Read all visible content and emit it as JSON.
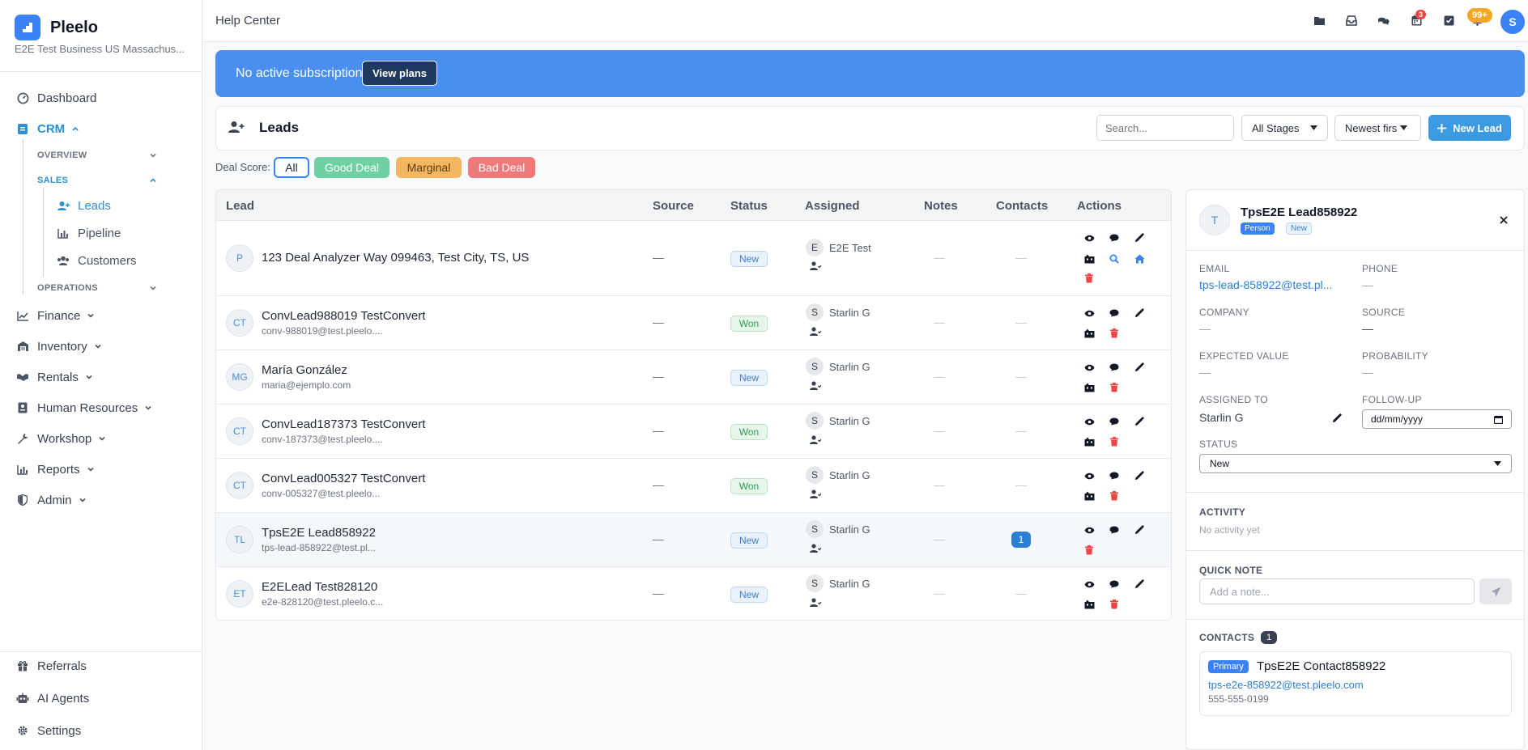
{
  "brand": {
    "name": "Pleelo",
    "subtitle": "E2E Test Business US Massachus..."
  },
  "sidebar": {
    "dashboard": "Dashboard",
    "crm": "CRM",
    "overview": "OVERVIEW",
    "sales": "SALES",
    "leads": "Leads",
    "pipeline": "Pipeline",
    "customers": "Customers",
    "operations": "OPERATIONS",
    "finance": "Finance",
    "inventory": "Inventory",
    "rentals": "Rentals",
    "human_resources": "Human Resources",
    "workshop": "Workshop",
    "reports": "Reports",
    "admin": "Admin",
    "referrals": "Referrals",
    "ai_agents": "AI Agents",
    "settings": "Settings"
  },
  "topbar": {
    "title": "Help Center",
    "calendar_badge": "3",
    "notif_badge": "99+",
    "user_initial": "S"
  },
  "banner": {
    "text": "No active subscription.",
    "button": "View plans"
  },
  "leads_header": {
    "title": "Leads",
    "search_placeholder": "Search...",
    "stage_select": "All Stages",
    "sort_select": "Newest firs",
    "new_button": "New Lead"
  },
  "deal_score": {
    "label": "Deal Score:",
    "chips": [
      "All",
      "Good Deal",
      "Marginal",
      "Bad Deal"
    ]
  },
  "table": {
    "headers": [
      "Lead",
      "Source",
      "Status",
      "Assigned",
      "Notes",
      "Contacts",
      "Actions"
    ],
    "rows": [
      {
        "initials": "P",
        "name": "123 Deal Analyzer Way 099463, Test City, TS, US",
        "email": "",
        "source": "—",
        "status": "New",
        "assigned_initial": "E",
        "assigned": "E2E Test",
        "notes": "—",
        "contacts": "—"
      },
      {
        "initials": "CT",
        "name": "ConvLead988019 TestConvert",
        "email": "conv-988019@test.pleelo....",
        "source": "—",
        "status": "Won",
        "assigned_initial": "S",
        "assigned": "Starlin G",
        "notes": "—",
        "contacts": "—"
      },
      {
        "initials": "MG",
        "name": "María González",
        "email": "maria@ejemplo.com",
        "source": "—",
        "status": "New",
        "assigned_initial": "S",
        "assigned": "Starlin G",
        "notes": "—",
        "contacts": "—"
      },
      {
        "initials": "CT",
        "name": "ConvLead187373 TestConvert",
        "email": "conv-187373@test.pleelo....",
        "source": "—",
        "status": "Won",
        "assigned_initial": "S",
        "assigned": "Starlin G",
        "notes": "—",
        "contacts": "—"
      },
      {
        "initials": "CT",
        "name": "ConvLead005327 TestConvert",
        "email": "conv-005327@test.pleelo...",
        "source": "—",
        "status": "Won",
        "assigned_initial": "S",
        "assigned": "Starlin G",
        "notes": "—",
        "contacts": "—"
      },
      {
        "initials": "TL",
        "name": "TpsE2E Lead858922",
        "email": "tps-lead-858922@test.pl...",
        "source": "—",
        "status": "New",
        "assigned_initial": "S",
        "assigned": "Starlin G",
        "notes": "—",
        "contacts": "1"
      },
      {
        "initials": "ET",
        "name": "E2ELead Test828120",
        "email": "e2e-828120@test.pleelo.c...",
        "source": "—",
        "status": "New",
        "assigned_initial": "S",
        "assigned": "Starlin G",
        "notes": "—",
        "contacts": "—"
      }
    ]
  },
  "detail": {
    "initial": "T",
    "name": "TpsE2E Lead858922",
    "tag_type": "Person",
    "tag_status": "New",
    "email_label": "EMAIL",
    "email": "tps-lead-858922@test.pl...",
    "phone_label": "PHONE",
    "phone": "—",
    "company_label": "COMPANY",
    "company": "—",
    "source_label": "SOURCE",
    "source": "—",
    "expected_label": "EXPECTED VALUE",
    "expected": "—",
    "probability_label": "PROBABILITY",
    "probability": "—",
    "assigned_label": "ASSIGNED TO",
    "assigned": "Starlin G",
    "followup_label": "FOLLOW-UP",
    "followup_placeholder": "dd/mm/yyyy",
    "status_label": "STATUS",
    "status_value": "New",
    "activity_label": "ACTIVITY",
    "activity_empty": "No activity yet",
    "quick_note_label": "QUICK NOTE",
    "note_placeholder": "Add a note...",
    "contacts_label": "CONTACTS",
    "contacts_count": "1",
    "contact": {
      "tag": "Primary",
      "name": "TpsE2E Contact858922",
      "email": "tps-e2e-858922@test.pleelo.com",
      "phone": "555-555-0199"
    }
  },
  "colors": {
    "accent": "#2b8fd6",
    "good_deal": "#6fd1a3",
    "marginal": "#f5b661",
    "bad_deal": "#ee7a7a"
  }
}
